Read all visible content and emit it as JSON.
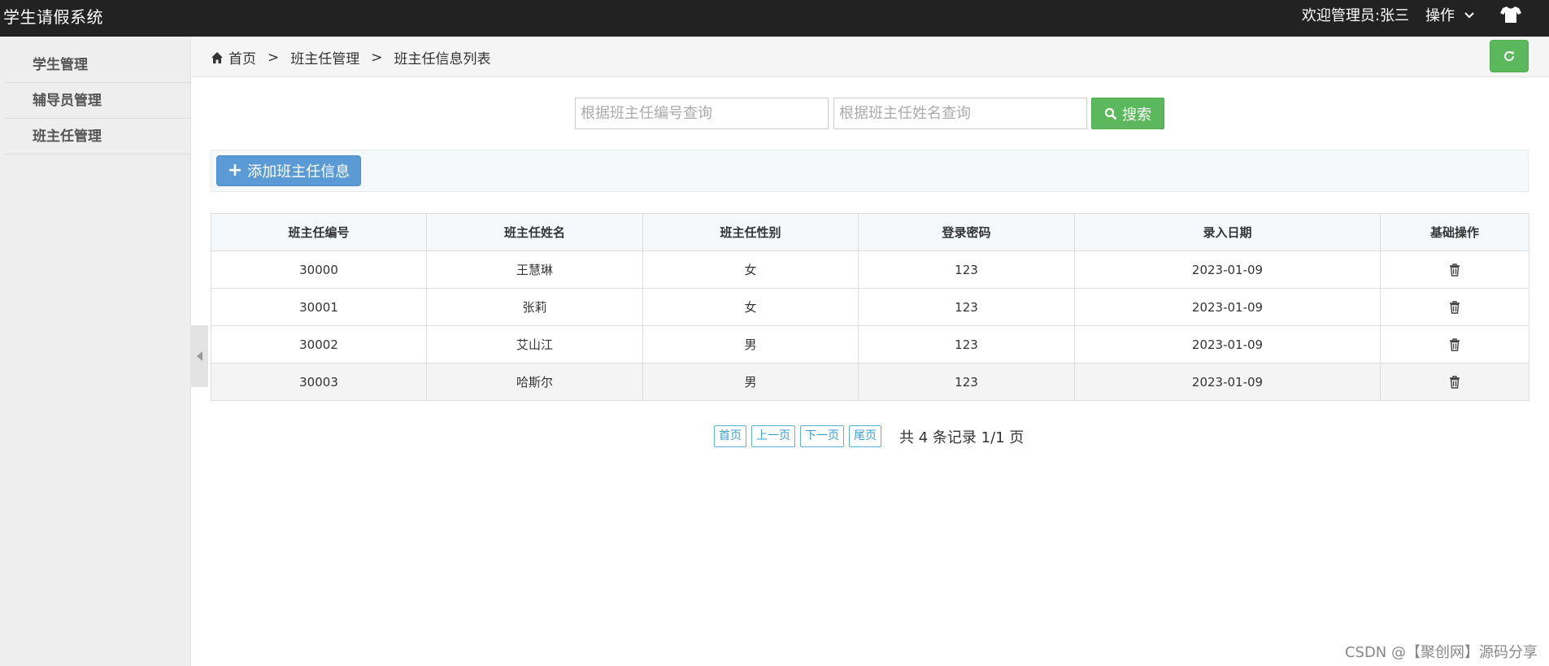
{
  "app": {
    "title": "学生请假系统"
  },
  "topbar": {
    "welcome": "欢迎管理员:张三",
    "ops_label": "操作"
  },
  "sidebar": {
    "items": [
      {
        "label": "学生管理"
      },
      {
        "label": "辅导员管理"
      },
      {
        "label": "班主任管理"
      }
    ]
  },
  "breadcrumb": {
    "items": [
      "首页",
      "班主任管理",
      "班主任信息列表"
    ],
    "separator": ">"
  },
  "search": {
    "id_placeholder": "根据班主任编号查询",
    "name_placeholder": "根据班主任姓名查询",
    "id_value": "",
    "name_value": "",
    "button_label": "搜索"
  },
  "toolbar": {
    "add_label": "添加班主任信息"
  },
  "table": {
    "columns": [
      "班主任编号",
      "班主任姓名",
      "班主任性别",
      "登录密码",
      "录入日期",
      "基础操作"
    ],
    "rows": [
      [
        "30000",
        "王慧琳",
        "女",
        "123",
        "2023-01-09"
      ],
      [
        "30001",
        "张莉",
        "女",
        "123",
        "2023-01-09"
      ],
      [
        "30002",
        "艾山江",
        "男",
        "123",
        "2023-01-09"
      ],
      [
        "30003",
        "哈斯尔",
        "男",
        "123",
        "2023-01-09"
      ]
    ]
  },
  "pagination": {
    "first": "首页",
    "prev": "上一页",
    "next": "下一页",
    "last": "尾页",
    "info": "共 4 条记录 1/1 页"
  },
  "watermark": "CSDN @【聚创网】源码分享",
  "colors": {
    "topbar": "#222222",
    "success": "#5cb85c",
    "primary": "#5b9bd5",
    "link": "#3a9fcf"
  }
}
